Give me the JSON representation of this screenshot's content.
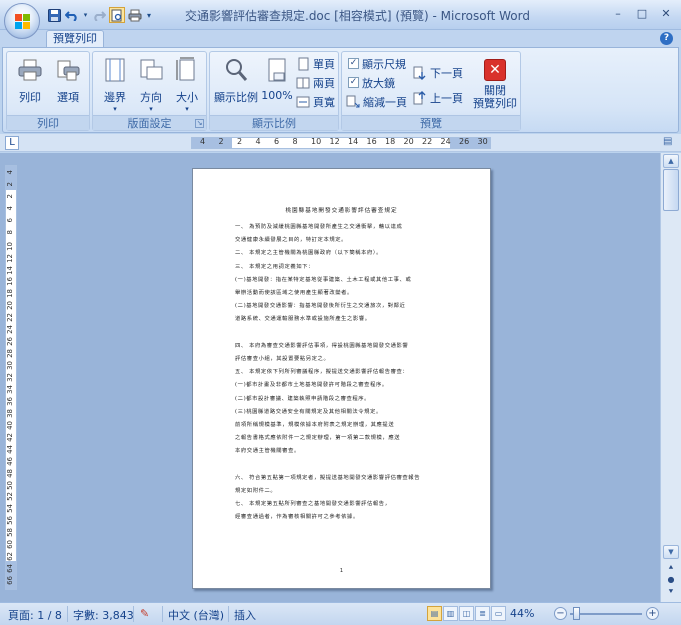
{
  "window": {
    "title": "交通影響評估審查規定.doc [相容模式] (預覽) - Microsoft Word",
    "minimize": "–",
    "maximize": "□",
    "close": "✕"
  },
  "quick_access": {
    "save_icon": "save-icon",
    "undo_icon": "undo-icon",
    "redo_icon": "redo-icon",
    "print_preview_icon": "print-preview-icon",
    "quick_print_icon": "quick-print-icon"
  },
  "ribbon": {
    "active_tab": "預覽列印",
    "groups": {
      "print": {
        "label": "列印",
        "print_button": "列印",
        "options_button": "選項"
      },
      "page_setup": {
        "label": "版面設定",
        "margins_button": "邊界",
        "orientation_button": "方向",
        "size_button": "大小"
      },
      "zoom": {
        "label": "顯示比例",
        "zoom_button": "顯示比例",
        "hundred_button": "100%",
        "one_page": "單頁",
        "two_pages": "兩頁",
        "page_width": "頁寬"
      },
      "preview": {
        "label": "預覽",
        "show_ruler": "顯示尺規",
        "show_ruler_checked": true,
        "magnifier": "放大鏡",
        "magnifier_checked": true,
        "shrink_one_page": "縮減一頁",
        "next_page": "下一頁",
        "prev_page": "上一頁",
        "close_preview": "關閉\n預覽列印"
      }
    }
  },
  "ruler": {
    "tab_selector": "L",
    "h_numbers": [
      "4",
      "2",
      "2",
      "4",
      "6",
      "8",
      "10",
      "12",
      "14",
      "16",
      "18",
      "20",
      "22",
      "24",
      "26",
      "30"
    ],
    "v_numbers": [
      "4",
      "2",
      "2",
      "4",
      "6",
      "8",
      "10",
      "12",
      "14",
      "16",
      "18",
      "20",
      "22",
      "24",
      "26",
      "28",
      "30",
      "32",
      "34",
      "36",
      "38",
      "40",
      "42",
      "44",
      "46",
      "48",
      "50",
      "52",
      "54",
      "56",
      "58",
      "60",
      "62",
      "64",
      "66"
    ]
  },
  "document": {
    "title": "桃園縣基地開發交通影響評估審查規定",
    "lines": [
      "一、  為預防及減緩桃園縣基地開發所產生之交通衝擊，藉以達成",
      "      交通健康永續發展之目的，特訂定本規定。",
      "二、  本規定之主管機關為桃園縣政府（以下簡稱本府）。",
      "三、  本規定之用詞定義如下：",
      "  (一)基地開發：指在某特定基地從事建築、土木工程或其他工事、或",
      "      舉辦活動而使該區域之使用產生顯著改變者。",
      "  (二)基地開發交通影響：指基地開發後所衍生之交通旅次，對鄰近",
      "      道路系統、交通運輸服務水準或設施所產生之影響。",
      "      ",
      "四、  本府為審查交通影響評估事項，得設桃園縣基地開發交通影響",
      "      評估審查小組，其設置要點另定之。",
      "五、  本規定依下列所列審議程序，擬提送交通影響評估報告審查：",
      "  (一)都市計畫及非都市土地基地開發許可階段之審查程序。",
      "  (二)都市設計審議、建築執照申請階段之審查程序。",
      "  (三)桃園縣道路交通安全有關規定及其他相關法令規定。",
      "      前項所稱規模基準，規模依據本府附表之規定辦理，其應提送",
      "      之報告書格式應依附件一之規定辦理，第一項第二款規模，應送",
      "      本府交通主管機關審查。",
      "      ",
      "六、  符合第五點第一項規定者，擬提送基地開發交通影響評估審查報告",
      "      規定如附件二。",
      "七、  本規定第五點所列審查之基地開發交通影響評估報告，",
      "      經審查通過者，作為審核相關許可之參考依據。"
    ],
    "page_number": "1"
  },
  "status": {
    "page": "頁面: 1 / 8",
    "words": "字數: 3,843",
    "language": "中文 (台灣)",
    "insert_mode": "插入",
    "zoom": "44%"
  },
  "colors": {
    "ribbon_text": "#15428b",
    "doc_background": "#99b4d9",
    "close_preview_red": "#d9312b"
  }
}
